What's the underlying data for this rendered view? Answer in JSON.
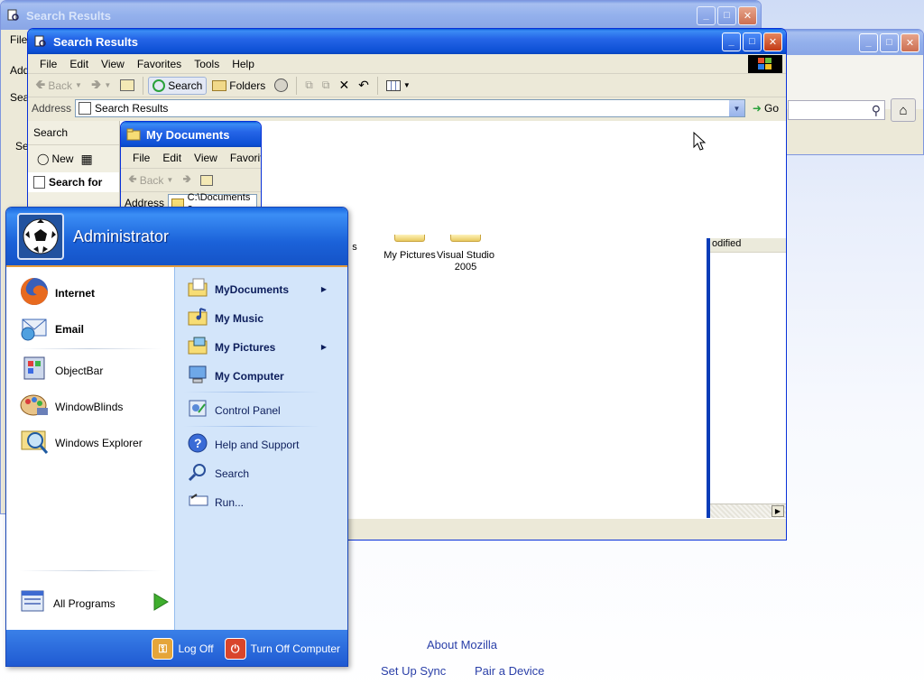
{
  "back_window": {
    "title": "Search Results",
    "menu_first": "File",
    "fragments": [
      "Add",
      "Sea",
      "Se"
    ]
  },
  "main_window": {
    "title": "Search Results",
    "menu": [
      "File",
      "Edit",
      "View",
      "Favorites",
      "Tools",
      "Help"
    ],
    "toolbar": {
      "back": "Back",
      "search": "Search",
      "folders": "Folders"
    },
    "address_label": "Address",
    "address_value": "Search Results",
    "go": "Go",
    "search_pane_title": "Search",
    "new_button": "New",
    "search_for": "Search for",
    "column_header": "odified",
    "icons": [
      {
        "label": "s"
      },
      {
        "label": "My Pictures"
      },
      {
        "label": "Visual Studio 2005"
      }
    ]
  },
  "my_documents_window": {
    "title": "My Documents",
    "menu": [
      "File",
      "Edit",
      "View",
      "Favorite"
    ],
    "back": "Back",
    "address_label": "Address",
    "address_value": "C:\\Documents a"
  },
  "start_menu": {
    "user": "Administrator",
    "pinned": [
      {
        "label": "Internet",
        "icon": "firefox-icon"
      },
      {
        "label": "Email",
        "icon": "email-icon"
      }
    ],
    "recent": [
      {
        "label": "ObjectBar",
        "icon": "objectbar-icon"
      },
      {
        "label": "WindowBlinds",
        "icon": "windowblinds-icon"
      },
      {
        "label": "Windows Explorer",
        "icon": "windows-explorer-icon"
      }
    ],
    "all_programs": "All Programs",
    "right": [
      {
        "label": "MyDocuments",
        "bold": true
      },
      {
        "label": "My Music",
        "bold": true
      },
      {
        "label": "My Pictures",
        "bold": true
      },
      {
        "label": "My Computer",
        "bold": true
      },
      {
        "label": "Control Panel",
        "bold": false
      },
      {
        "label": "Help and Support",
        "bold": false
      },
      {
        "label": "Search",
        "bold": false
      },
      {
        "label": "Run...",
        "bold": false
      }
    ],
    "log_off": "Log Off",
    "turn_off": "Turn Off Computer"
  },
  "desktop_links": {
    "about": "About Mozilla",
    "sync": "Set Up Sync",
    "pair": "Pair a Device"
  },
  "colors": {
    "xp_blue": "#0a50d0",
    "start_right_bg": "#d3e5fa",
    "link": "#2a3fa8"
  }
}
